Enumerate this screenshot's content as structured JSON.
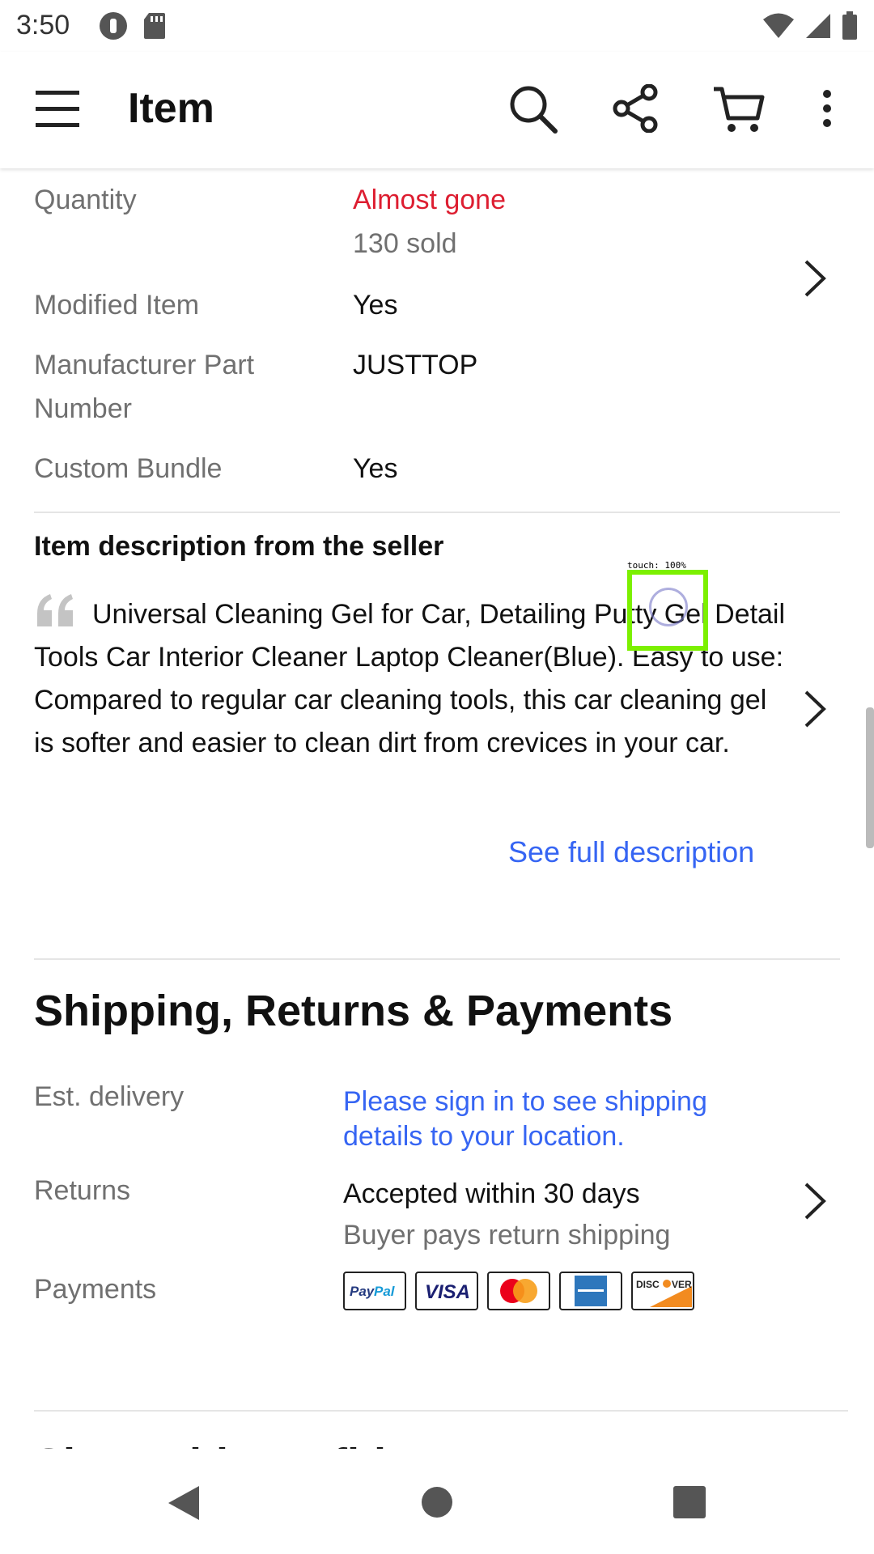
{
  "status": {
    "time": "3:50"
  },
  "appbar": {
    "title": "Item"
  },
  "specs": [
    {
      "label": "Quantity",
      "value": "Almost gone",
      "sub": "130 sold"
    },
    {
      "label": "Modified Item",
      "value": "Yes"
    },
    {
      "label": "Manufacturer Part Number",
      "value": "JUSTTOP"
    },
    {
      "label": "Custom Bundle",
      "value": "Yes"
    }
  ],
  "description": {
    "heading": "Item description from the seller",
    "text": "Universal Cleaning Gel for Car, Detailing Putty Gel Detail Tools Car Interior Cleaner Laptop Cleaner(Blue). Easy to use: Compared to regular car cleaning tools, this car cleaning gel is softer and easier to clean dirt from crevices in your car.",
    "see_full": "See full description"
  },
  "shipping": {
    "title": "Shipping, Returns & Payments",
    "delivery_label": "Est. delivery",
    "delivery_value": "Please sign in to see shipping details to your location.",
    "returns_label": "Returns",
    "returns_value": "Accepted within 30 days",
    "returns_sub": "Buyer pays return shipping",
    "payments_label": "Payments",
    "payment_methods": [
      "PayPal",
      "VISA",
      "Mastercard",
      "American Express",
      "DISCOVER"
    ]
  },
  "next_section_partial": "Shop with confidence",
  "touch_indicator": "touch: 100%",
  "colors": {
    "alert_red": "#dd1e31",
    "link_blue": "#3665f3",
    "touch_green": "#7cf000"
  }
}
